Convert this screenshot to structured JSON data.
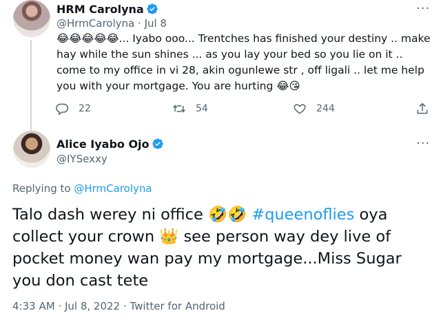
{
  "reply_to_tweet": {
    "author_name": "HRM Carolyna",
    "author_handle": "@HrmCarolyna",
    "dot": "·",
    "date": "Jul 8",
    "text": "😂😂😂😂😂... Iyabo ooo... Trentches has finished your destiny .. make hay while the sun shines ... as you lay your bed so you lie on it .. come to my office in vi 28, akin ogunlewe str , off ligali .. let me help you with your mortgage. You are hurting 😂😘",
    "reply_count": "22",
    "retweet_count": "54",
    "like_count": "244",
    "more_label": "···"
  },
  "main_tweet": {
    "author_name": "Alice Iyabo Ojo",
    "author_handle": "@IYSexxy",
    "more_label": "···",
    "replying_prefix": "Replying to",
    "replying_to": "@HrmCarolyna",
    "text_part1": "Talo dash werey ni office 🤣🤣 ",
    "hashtag": "#queenoflies",
    "text_part2": " oya collect your crown 👑 see person way dey live of pocket money wan pay my mortgage...Miss Sugar you don cast tete",
    "timestamp": "4:33 AM · Jul 8, 2022 · Twitter for Android"
  },
  "colors": {
    "verified": "#1d9bf0",
    "link": "#1d9bf0",
    "secondary_text": "#536471"
  }
}
